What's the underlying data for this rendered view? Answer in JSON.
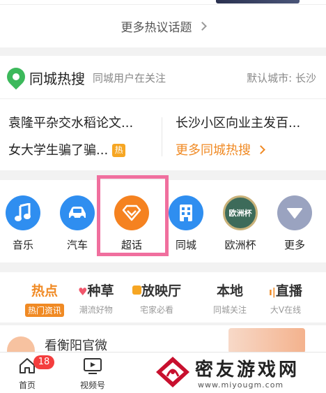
{
  "more_topics": {
    "label": "更多热议话题"
  },
  "local_hot": {
    "title": "同城热搜",
    "subtitle": "同城用户在关注",
    "city": "默认城市: 长沙",
    "items": [
      "袁隆平杂交水稻论文...",
      "长沙小区向业主发百...",
      "女大学生骗了骗..."
    ],
    "hot_badge": "热",
    "more_link": "更多同城热搜"
  },
  "icon_row": [
    {
      "label": "音乐",
      "icon": "music-icon",
      "color": "#2f8ef0"
    },
    {
      "label": "汽车",
      "icon": "car-icon",
      "color": "#2f8ef0"
    },
    {
      "label": "超话",
      "icon": "diamond-icon",
      "color": "#f58220"
    },
    {
      "label": "同城",
      "icon": "city-icon",
      "color": "#2f8ef0"
    },
    {
      "label": "欧洲杯",
      "icon": "euro-cup-icon",
      "color": "#3d6b5a",
      "icon_text": "欧洲杯"
    },
    {
      "label": "更多",
      "icon": "more-down-icon",
      "color": "#9aa3c0"
    }
  ],
  "tabs": [
    {
      "label": "热点",
      "sub": "热门资讯"
    },
    {
      "label": "种草",
      "sub": "潮流好物"
    },
    {
      "label": "放映厅",
      "sub": "宅家必看"
    },
    {
      "label": "本地",
      "sub": "同城关注"
    },
    {
      "label": "直播",
      "sub": "大V在线"
    }
  ],
  "feed": {
    "name": "看衡阳官微"
  },
  "bottom_nav": [
    {
      "label": "首页",
      "badge": "18"
    },
    {
      "label": "视频号"
    }
  ],
  "watermark": {
    "text": "密友游戏网",
    "url": "www.miyougm.com"
  },
  "colors": {
    "accent": "#f08a24",
    "highlight": "#f06f9e",
    "pin": "#3cb95b",
    "badge": "#f43d3d"
  }
}
